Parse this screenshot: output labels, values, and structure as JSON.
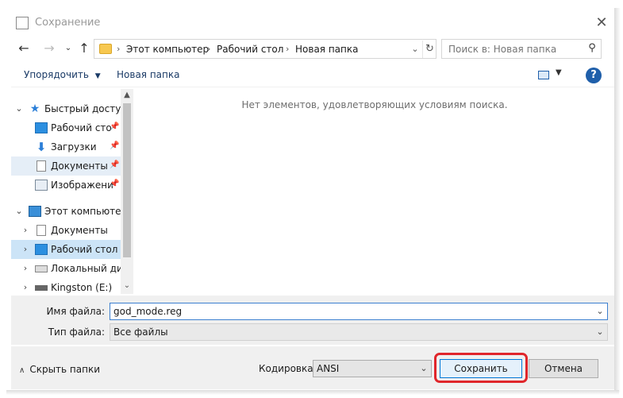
{
  "window": {
    "title": "Сохранение",
    "close_icon": "close-icon"
  },
  "nav": {
    "back_icon": "back-arrow-icon",
    "forward_icon": "forward-arrow-icon",
    "recent_icon": "chevron-down-icon",
    "up_icon": "up-arrow-icon",
    "breadcrumbs": [
      "Этот компьютер",
      "Рабочий стол",
      "Новая папка"
    ],
    "search_placeholder": "Поиск в: Новая папка"
  },
  "toolbar": {
    "organize_label": "Упорядочить",
    "new_folder_label": "Новая папка",
    "help_label": "?"
  },
  "navpane": {
    "quick_access": "Быстрый доступ",
    "quick_items": [
      {
        "label": "Рабочий сто",
        "icon": "desktop-icon"
      },
      {
        "label": "Загрузки",
        "icon": "downloads-icon"
      },
      {
        "label": "Документы",
        "icon": "documents-icon"
      },
      {
        "label": "Изображени",
        "icon": "pictures-icon"
      }
    ],
    "this_pc": "Этот компьютер",
    "pc_items": [
      {
        "label": "Документы",
        "icon": "documents-icon"
      },
      {
        "label": "Рабочий стол",
        "icon": "desktop-icon"
      },
      {
        "label": "Локальный дис",
        "icon": "drive-icon"
      },
      {
        "label": "Kingston (E:)",
        "icon": "usb-drive-icon"
      }
    ]
  },
  "main": {
    "empty_message": "Нет элементов, удовлетворяющих условиям поиска."
  },
  "fields": {
    "filename_label": "Имя файла:",
    "filename_value": "god_mode.reg",
    "filetype_label": "Тип файла:",
    "filetype_value": "Все файлы"
  },
  "footer": {
    "hide_folders_label": "Скрыть папки",
    "encoding_label": "Кодировка:",
    "encoding_value": "ANSI",
    "save_label": "Сохранить",
    "cancel_label": "Отмена"
  },
  "colors": {
    "accent": "#0078d7",
    "highlight": "#e0262b",
    "help": "#1f5faa"
  }
}
